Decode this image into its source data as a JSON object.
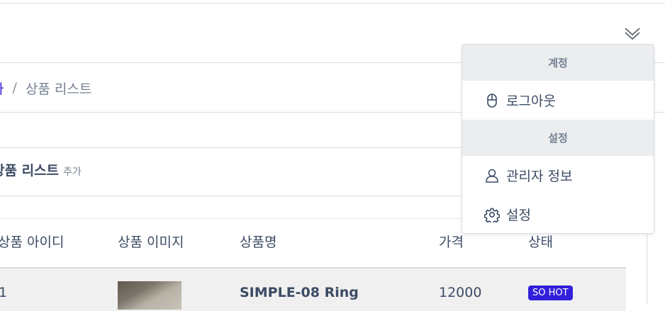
{
  "header": {
    "toggle_icon": "chevron-double-down-icon"
  },
  "breadcrumb": {
    "parent": "차",
    "separator": "/",
    "current": "상품 리스트"
  },
  "card": {
    "title": "상품 리스트",
    "subtitle": "추가"
  },
  "table": {
    "columns": [
      "상품 아이디",
      "상품 이미지",
      "상품명",
      "가격",
      "상태"
    ],
    "rows": [
      {
        "id": "1",
        "image": "ring-photo",
        "name": "SIMPLE-08 Ring",
        "price": "12000",
        "status": "SO HOT"
      }
    ]
  },
  "dropdown": {
    "account_header": "계정",
    "logout": {
      "label": "로그아웃",
      "icon": "mouse-icon"
    },
    "settings_header": "설정",
    "admin_info": {
      "label": "관리자 정보",
      "icon": "user-icon"
    },
    "settings": {
      "label": "설정",
      "icon": "gear-icon"
    }
  },
  "colors": {
    "primary": "#321fdb",
    "text": "#3c4b64",
    "muted": "#768192",
    "border": "#d8dbe0",
    "header_bg": "#ebedef"
  }
}
